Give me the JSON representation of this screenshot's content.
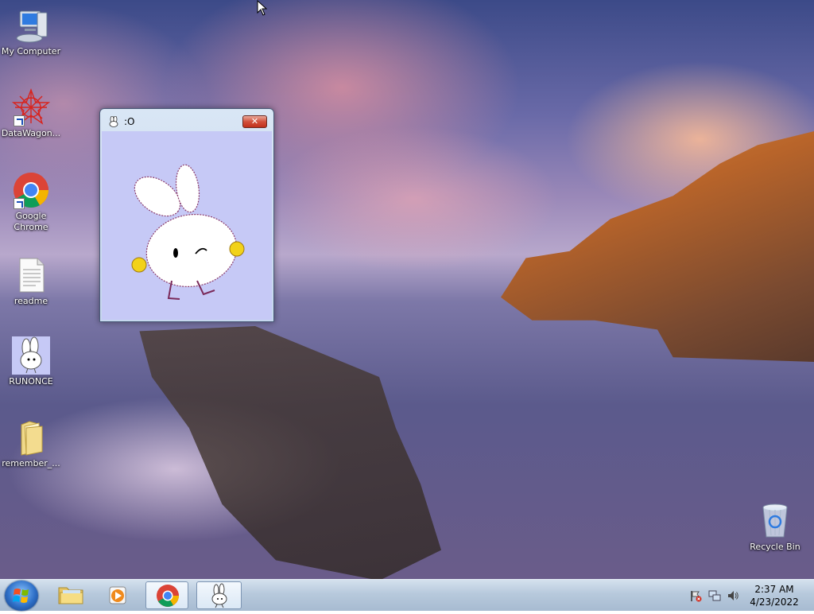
{
  "desktop": {
    "icons": [
      {
        "label": "My Computer",
        "icon": "computer-icon"
      },
      {
        "label": "DataWagon...",
        "icon": "datawagon-shortcut-icon"
      },
      {
        "label": "Google Chrome",
        "icon": "chrome-shortcut-icon"
      },
      {
        "label": "readme",
        "icon": "text-file-icon"
      },
      {
        "label": "RUNONCE",
        "icon": "bunny-app-icon"
      },
      {
        "label": "remember_...",
        "icon": "folder-icon"
      },
      {
        "label": "Recycle Bin",
        "icon": "recycle-bin-icon"
      }
    ]
  },
  "window": {
    "title": ":O",
    "close_label": "✕",
    "client_bg": "#c6c9f6"
  },
  "taskbar": {
    "items": [
      {
        "name": "windows-explorer",
        "icon": "folder-icon"
      },
      {
        "name": "media-player",
        "icon": "media-player-icon"
      },
      {
        "name": "google-chrome",
        "icon": "chrome-icon"
      },
      {
        "name": "bunny-app",
        "icon": "bunny-app-icon",
        "active": true
      }
    ],
    "clock": {
      "time": "2:37 AM",
      "date": "4/23/2022"
    }
  },
  "colors": {
    "accent": "#2e6fc7",
    "close_red": "#c0301c",
    "bunny_yellow": "#f2d21a"
  }
}
